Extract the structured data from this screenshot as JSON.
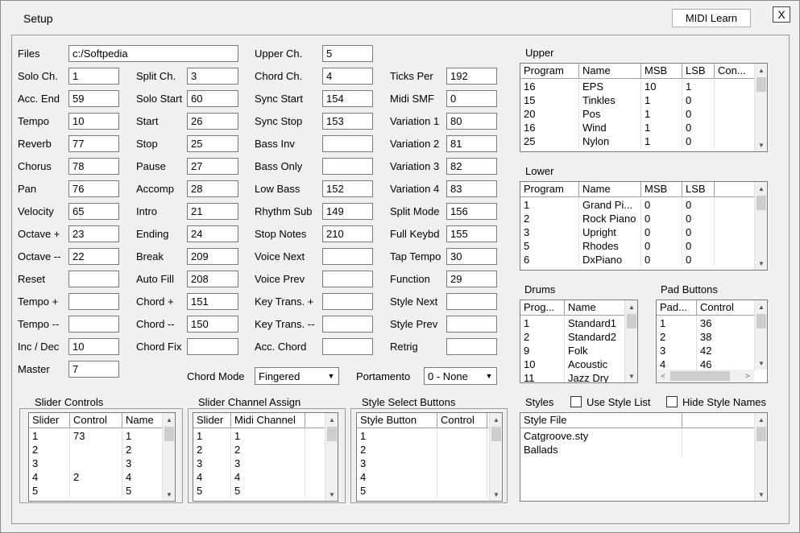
{
  "window": {
    "title": "Setup",
    "midi_learn": "MIDI Learn",
    "close": "X"
  },
  "col1": [
    {
      "label": "Files",
      "value": "c:/Softpedia"
    },
    {
      "label": "Solo Ch.",
      "value": "1"
    },
    {
      "label": "Acc. End",
      "value": "59"
    },
    {
      "label": "Tempo",
      "value": "10"
    },
    {
      "label": "Reverb",
      "value": "77"
    },
    {
      "label": "Chorus",
      "value": "78"
    },
    {
      "label": "Pan",
      "value": "76"
    },
    {
      "label": "Velocity",
      "value": "65"
    },
    {
      "label": "Octave +",
      "value": "23"
    },
    {
      "label": "Octave --",
      "value": "22"
    },
    {
      "label": "Reset",
      "value": ""
    },
    {
      "label": "Tempo +",
      "value": ""
    },
    {
      "label": "Tempo --",
      "value": ""
    },
    {
      "label": "Inc / Dec",
      "value": "10"
    },
    {
      "label": "Master",
      "value": "7"
    }
  ],
  "col2": [
    {
      "label": "Split Ch.",
      "value": "3"
    },
    {
      "label": "Solo Start",
      "value": "60"
    },
    {
      "label": "Start",
      "value": "26"
    },
    {
      "label": "Stop",
      "value": "25"
    },
    {
      "label": "Pause",
      "value": "27"
    },
    {
      "label": "Accomp",
      "value": "28"
    },
    {
      "label": "Intro",
      "value": "21"
    },
    {
      "label": "Ending",
      "value": "24"
    },
    {
      "label": "Break",
      "value": "209"
    },
    {
      "label": "Auto Fill",
      "value": "208"
    },
    {
      "label": "Chord +",
      "value": "151"
    },
    {
      "label": "Chord --",
      "value": "150"
    },
    {
      "label": "Chord Fix",
      "value": ""
    }
  ],
  "col3": [
    {
      "label": "Upper Ch.",
      "value": "5"
    },
    {
      "label": "Chord Ch.",
      "value": "4"
    },
    {
      "label": "Sync Start",
      "value": "154"
    },
    {
      "label": "Sync Stop",
      "value": "153"
    },
    {
      "label": "Bass Inv",
      "value": ""
    },
    {
      "label": "Bass Only",
      "value": ""
    },
    {
      "label": "Low Bass",
      "value": "152"
    },
    {
      "label": "Rhythm Sub",
      "value": "149"
    },
    {
      "label": "Stop Notes",
      "value": "210"
    },
    {
      "label": "Voice Next",
      "value": ""
    },
    {
      "label": "Voice Prev",
      "value": ""
    },
    {
      "label": "Key Trans. +",
      "value": ""
    },
    {
      "label": "Key Trans. --",
      "value": ""
    },
    {
      "label": "Acc. Chord",
      "value": ""
    }
  ],
  "col4": [
    {
      "label": "Ticks Per",
      "value": "192"
    },
    {
      "label": "Midi SMF",
      "value": "0"
    },
    {
      "label": "Variation 1",
      "value": "80"
    },
    {
      "label": "Variation 2",
      "value": "81"
    },
    {
      "label": "Variation 3",
      "value": "82"
    },
    {
      "label": "Variation 4",
      "value": "83"
    },
    {
      "label": "Split Mode",
      "value": "156"
    },
    {
      "label": "Full Keybd",
      "value": "155"
    },
    {
      "label": "Tap Tempo",
      "value": "30"
    },
    {
      "label": "Function",
      "value": "29"
    },
    {
      "label": "Style Next",
      "value": ""
    },
    {
      "label": "Style Prev",
      "value": ""
    },
    {
      "label": "Retrig",
      "value": ""
    }
  ],
  "chord_mode": {
    "label": "Chord Mode",
    "value": "Fingered"
  },
  "portamento": {
    "label": "Portamento",
    "value": "0 - None"
  },
  "upper": {
    "title": "Upper",
    "headers": [
      "Program",
      "Name",
      "MSB",
      "LSB",
      "Con..."
    ],
    "rows": [
      [
        "16",
        "EPS",
        "10",
        "1",
        ""
      ],
      [
        "15",
        "Tinkles",
        "1",
        "0",
        ""
      ],
      [
        "20",
        "Pos",
        "1",
        "0",
        ""
      ],
      [
        "16",
        "Wind",
        "1",
        "0",
        ""
      ],
      [
        "25",
        "Nylon",
        "1",
        "0",
        ""
      ]
    ]
  },
  "lower": {
    "title": "Lower",
    "headers": [
      "Program",
      "Name",
      "MSB",
      "LSB",
      ""
    ],
    "rows": [
      [
        "1",
        "Grand Pi...",
        "0",
        "0",
        ""
      ],
      [
        "2",
        "Rock Piano",
        "0",
        "0",
        ""
      ],
      [
        "3",
        "Upright",
        "0",
        "0",
        ""
      ],
      [
        "5",
        "Rhodes",
        "0",
        "0",
        ""
      ],
      [
        "6",
        "DxPiano",
        "0",
        "0",
        ""
      ]
    ]
  },
  "drums": {
    "title": "Drums",
    "headers": [
      "Prog...",
      "Name"
    ],
    "rows": [
      [
        "1",
        "Standard1"
      ],
      [
        "2",
        "Standard2"
      ],
      [
        "9",
        "Folk"
      ],
      [
        "10",
        "Acoustic"
      ],
      [
        "11",
        "Jazz Dry"
      ]
    ]
  },
  "pad_buttons": {
    "title": "Pad Buttons",
    "headers": [
      "Pad...",
      "Control"
    ],
    "rows": [
      [
        "1",
        "36"
      ],
      [
        "2",
        "38"
      ],
      [
        "3",
        "42"
      ],
      [
        "4",
        "46"
      ]
    ]
  },
  "slider_controls": {
    "title": "Slider Controls",
    "headers": [
      "Slider",
      "Control",
      "Name"
    ],
    "rows": [
      [
        "1",
        "73",
        "1"
      ],
      [
        "2",
        "",
        "2"
      ],
      [
        "3",
        "",
        "3"
      ],
      [
        "4",
        "2",
        "4"
      ],
      [
        "5",
        "",
        "5"
      ]
    ]
  },
  "slider_channel": {
    "title": "Slider Channel Assign",
    "headers": [
      "Slider",
      "Midi Channel",
      ""
    ],
    "rows": [
      [
        "1",
        "1",
        ""
      ],
      [
        "2",
        "2",
        ""
      ],
      [
        "3",
        "3",
        ""
      ],
      [
        "4",
        "4",
        ""
      ],
      [
        "5",
        "5",
        ""
      ]
    ]
  },
  "style_select": {
    "title": "Style Select Buttons",
    "headers": [
      "Style Button",
      "Control",
      ""
    ],
    "rows": [
      [
        "1",
        "",
        ""
      ],
      [
        "2",
        "",
        ""
      ],
      [
        "3",
        "",
        ""
      ],
      [
        "4",
        "",
        ""
      ],
      [
        "5",
        "",
        ""
      ]
    ]
  },
  "styles": {
    "title": "Styles",
    "use_style_list": "Use Style List",
    "hide_style_names": "Hide Style Names",
    "headers": [
      "Style File",
      ""
    ],
    "rows": [
      [
        "Catgroove.sty",
        ""
      ],
      [
        "Ballads",
        ""
      ]
    ]
  }
}
